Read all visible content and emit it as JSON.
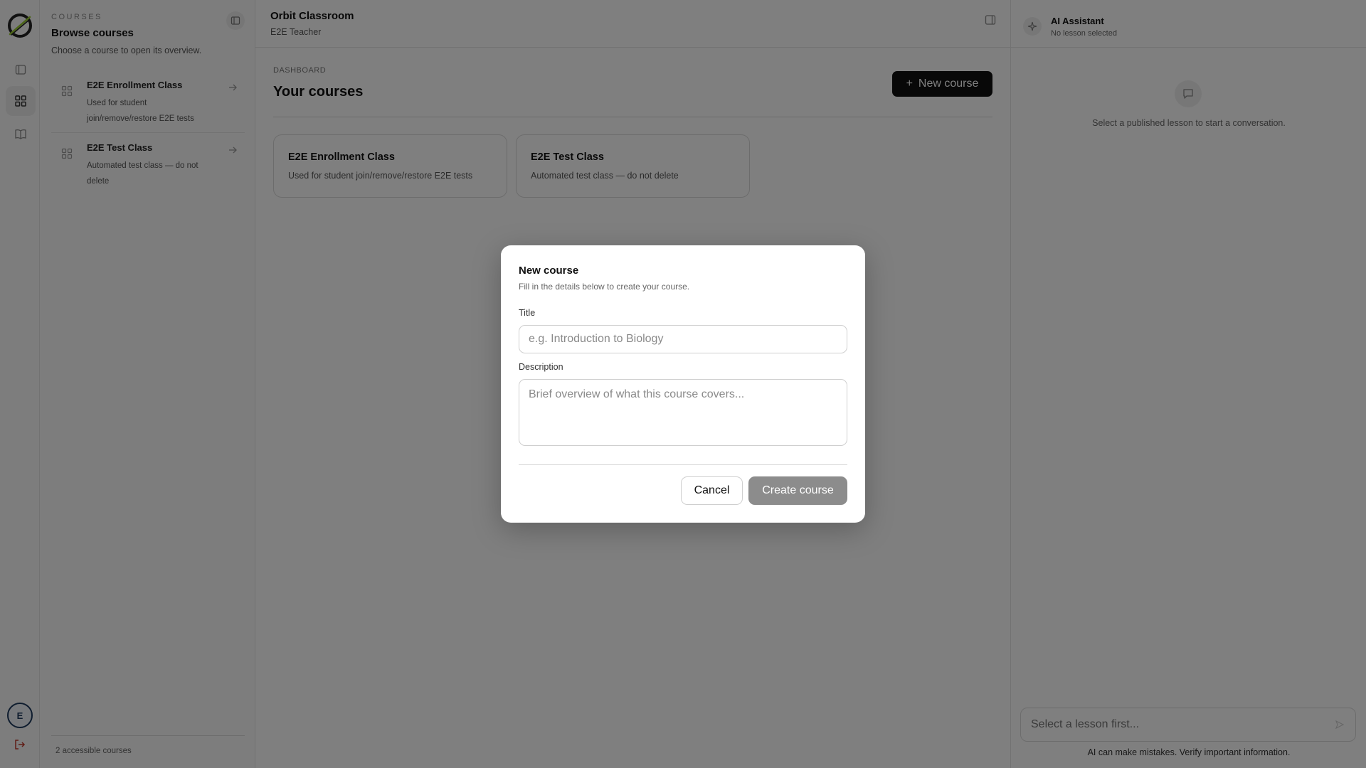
{
  "rail": {
    "avatar_initial": "E"
  },
  "sidebar": {
    "eyebrow": "COURSES",
    "title": "Browse courses",
    "subtitle": "Choose a course to open its overview.",
    "items": [
      {
        "name": "E2E Enrollment Class",
        "description": "Used for student join/remove/restore E2E tests"
      },
      {
        "name": "E2E Test Class",
        "description": "Automated test class — do not delete"
      }
    ],
    "footer": "2 accessible courses"
  },
  "header": {
    "title": "Orbit Classroom",
    "subtitle": "E2E Teacher"
  },
  "main": {
    "eyebrow": "DASHBOARD",
    "title": "Your courses",
    "new_button_icon": "+",
    "new_button_label": "New course",
    "cards": [
      {
        "title": "E2E Enrollment Class",
        "description": "Used for student join/remove/restore E2E tests"
      },
      {
        "title": "E2E Test Class",
        "description": "Automated test class — do not delete"
      }
    ]
  },
  "assistant": {
    "title": "AI Assistant",
    "subtitle": "No lesson selected",
    "empty_message": "Select a published lesson to start a conversation.",
    "input_placeholder": "Select a lesson first...",
    "disclaimer": "AI can make mistakes. Verify important information."
  },
  "modal": {
    "title": "New course",
    "subtitle": "Fill in the details below to create your course.",
    "title_label": "Title",
    "title_placeholder": "e.g. Introduction to Biology",
    "title_value": "",
    "description_label": "Description",
    "description_placeholder": "Brief overview of what this course covers...",
    "description_value": "",
    "cancel_label": "Cancel",
    "create_label": "Create course"
  },
  "colors": {
    "primary_button": "#111111",
    "disabled_button": "#8c8c8c",
    "avatar_ring": "#1f3a5f",
    "logout_icon": "#c0392b",
    "logo_accent": "#9acd32"
  }
}
